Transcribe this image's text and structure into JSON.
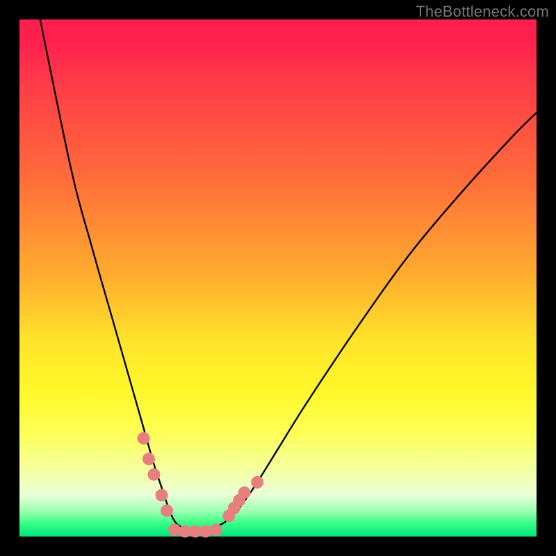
{
  "watermark": "TheBottleneck.com",
  "chart_data": {
    "type": "line",
    "title": "",
    "xlabel": "",
    "ylabel": "",
    "xlim": [
      0,
      100
    ],
    "ylim": [
      0,
      100
    ],
    "grid": false,
    "series": [
      {
        "name": "curve",
        "color": "#000000",
        "x": [
          4,
          10,
          14,
          18,
          22,
          24,
          26,
          28,
          29,
          30,
          31,
          33,
          35,
          40,
          45,
          55,
          65,
          75,
          85,
          95,
          100
        ],
        "values": [
          100,
          71,
          56,
          42,
          28,
          21,
          14,
          8,
          5,
          3,
          2,
          1,
          1,
          3,
          9,
          25,
          40,
          54,
          66,
          77,
          82
        ]
      }
    ],
    "markers": [
      {
        "name": "left-dots",
        "color": "#e87f7f",
        "shape": "circle",
        "x": [
          24.0,
          25.0,
          26.0,
          27.5,
          28.5
        ],
        "values": [
          19.0,
          15.0,
          12.0,
          8.0,
          5.0
        ]
      },
      {
        "name": "right-dots",
        "color": "#e87f7f",
        "shape": "circle",
        "x": [
          40.5,
          41.5,
          42.5,
          43.5,
          46.0
        ],
        "values": [
          4.0,
          5.5,
          7.0,
          8.5,
          10.5
        ]
      },
      {
        "name": "bottom-dots",
        "color": "#e87f7f",
        "shape": "circle",
        "x": [
          30.0,
          32.0,
          34.0,
          36.0,
          38.0
        ],
        "values": [
          1.3,
          1.0,
          1.0,
          1.0,
          1.3
        ]
      }
    ],
    "colors": {
      "gradient_top": "#ff1f4f",
      "gradient_mid": "#ffe32a",
      "gradient_bottom": "#00e37a",
      "curve": "#000000",
      "marker": "#e87f7f",
      "frame": "#000000"
    }
  }
}
